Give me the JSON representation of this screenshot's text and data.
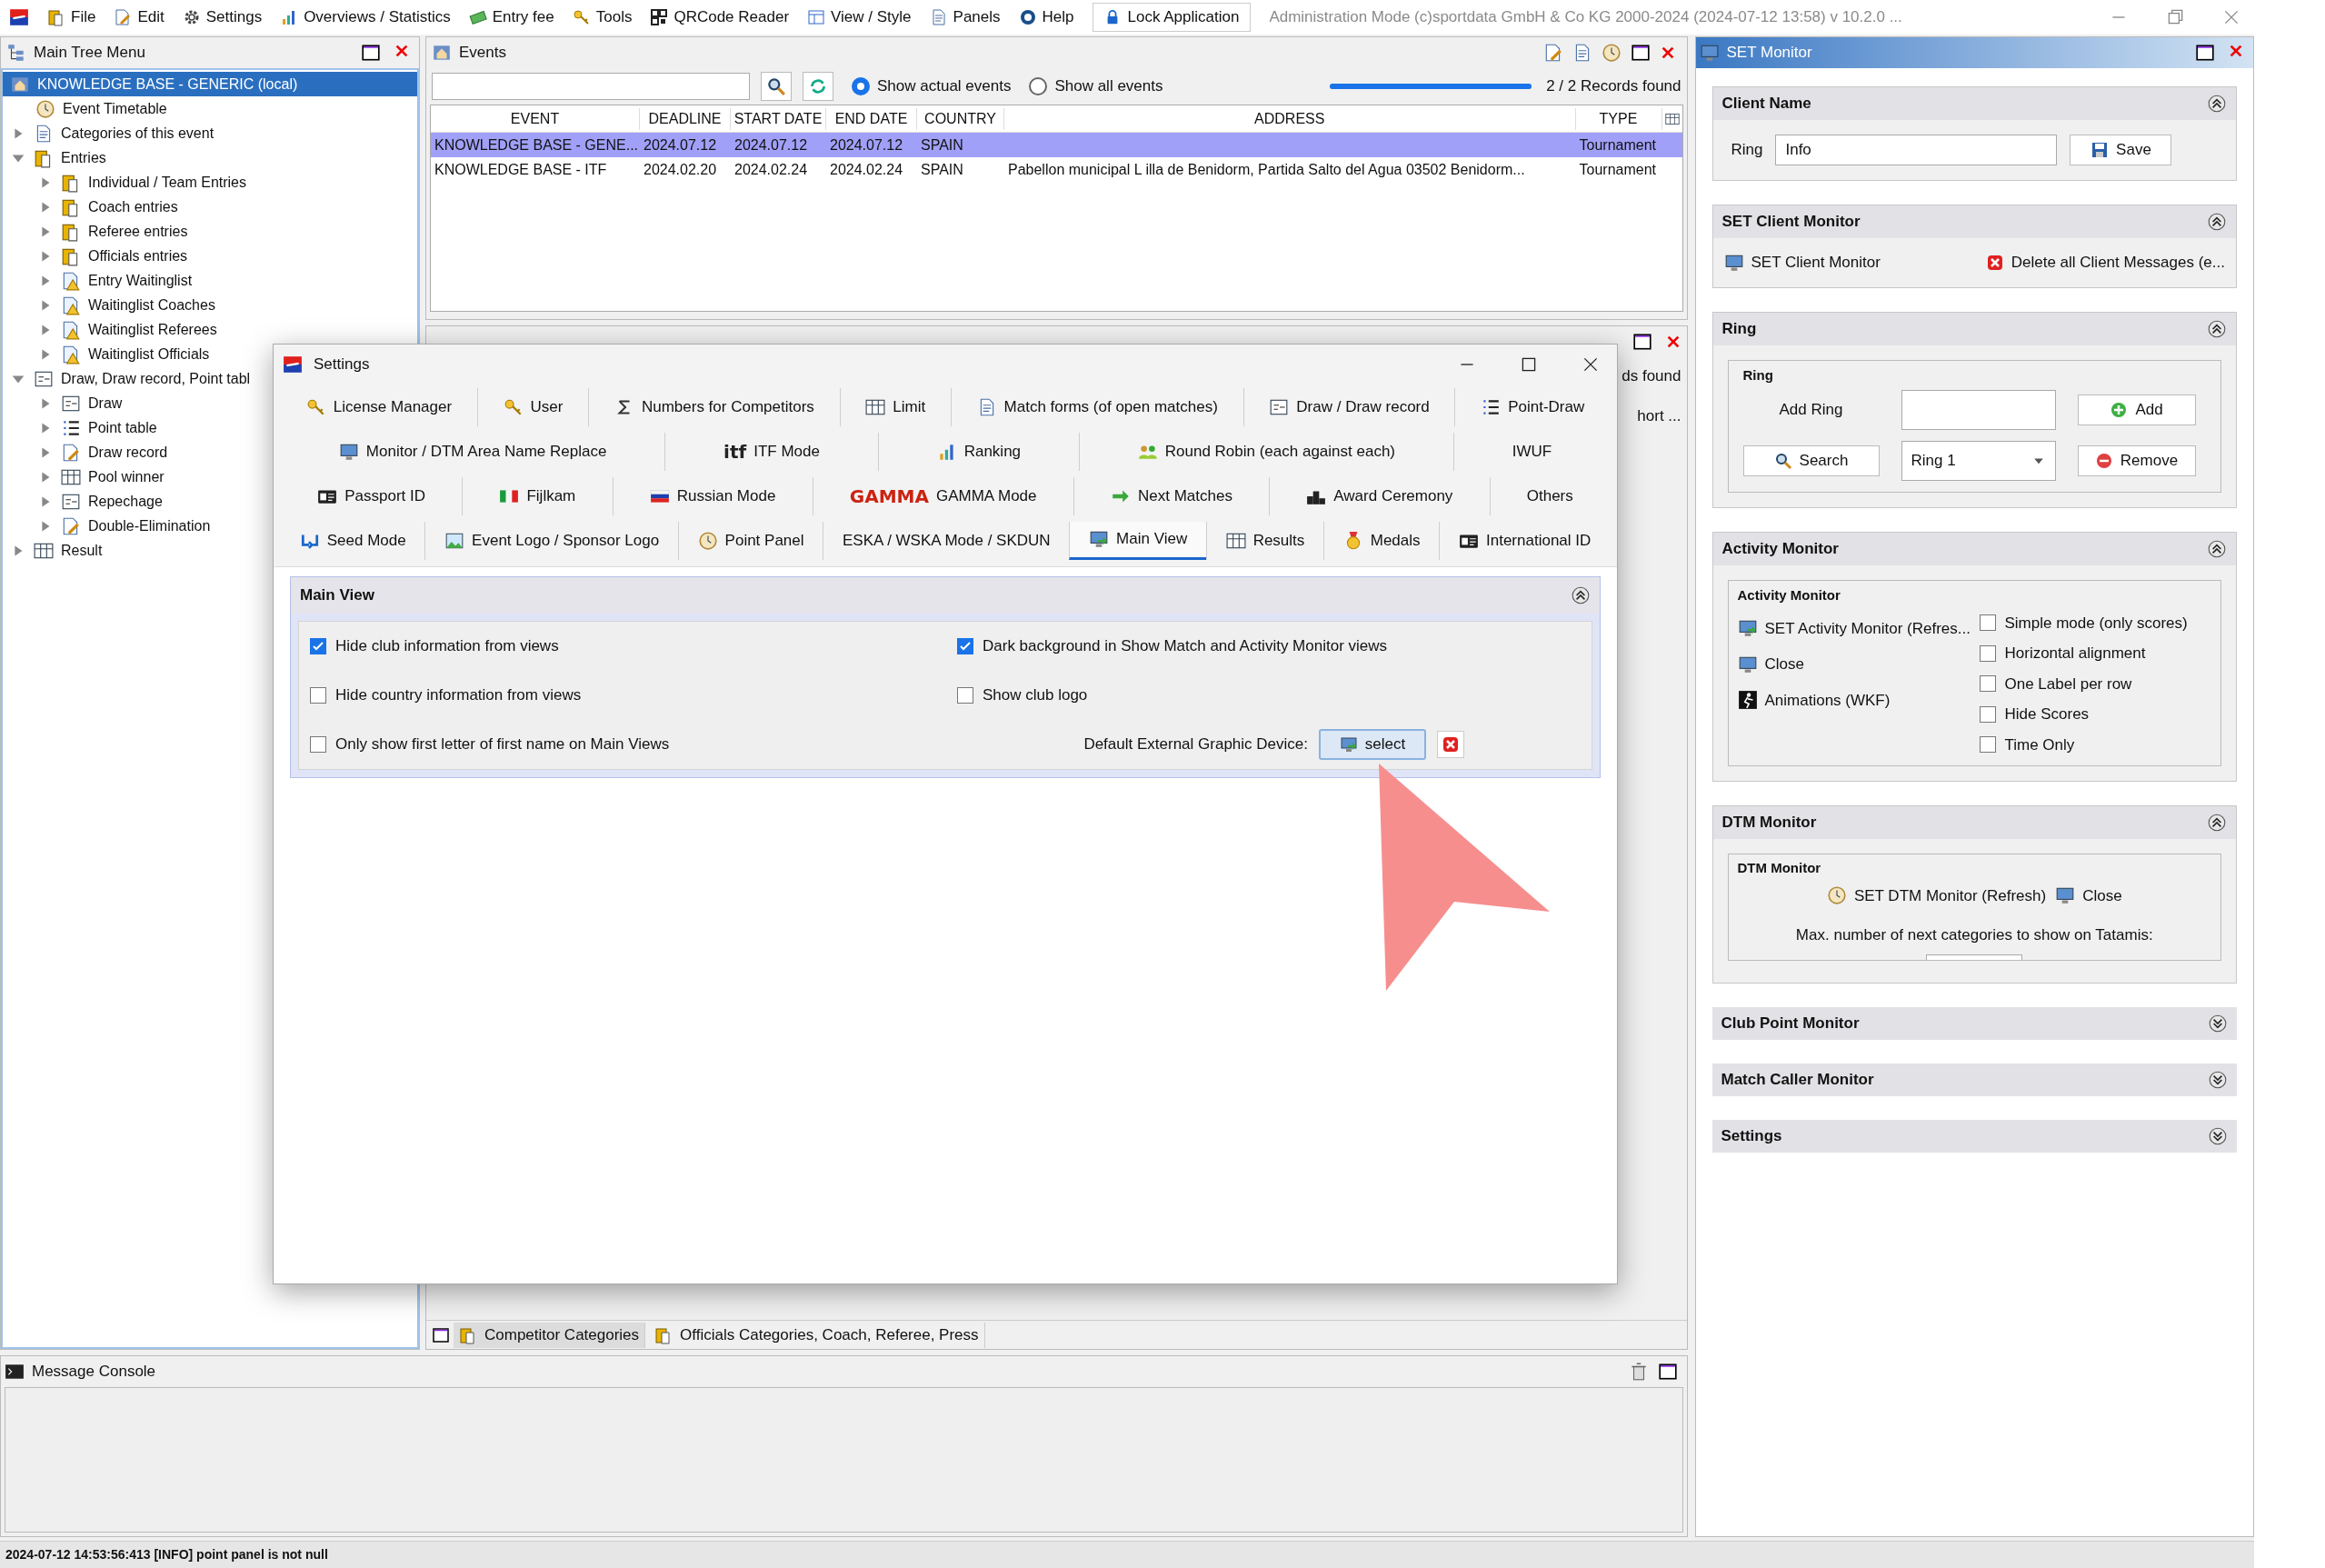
{
  "menu_bar": {
    "items": [
      {
        "label": "File"
      },
      {
        "label": "Edit"
      },
      {
        "label": "Settings"
      },
      {
        "label": "Overviews / Statistics"
      },
      {
        "label": "Entry fee"
      },
      {
        "label": "Tools"
      },
      {
        "label": "QRCode Reader"
      },
      {
        "label": "View / Style"
      },
      {
        "label": "Panels"
      },
      {
        "label": "Help"
      }
    ],
    "lock_button": "Lock Application",
    "title": "Administration Mode (c)sportdata GmbH & Co KG 2000-2024 (2024-07-12 13:58)  v 10.2.0 ..."
  },
  "main_tree": {
    "title": "Main Tree Menu",
    "root": {
      "label": "KNOWLEDGE BASE - GENERIC (local)",
      "selected": true,
      "children": [
        {
          "label": "Event Timetable",
          "selected": false
        },
        {
          "label": "Categories of this event",
          "selected": false,
          "expanded": false
        },
        {
          "label": "Entries",
          "selected": false,
          "expanded": true,
          "children": [
            {
              "label": "Individual / Team Entries",
              "selected": false,
              "expanded": false
            },
            {
              "label": "Coach entries",
              "selected": false,
              "expanded": false
            },
            {
              "label": "Referee entries",
              "selected": false,
              "expanded": false
            },
            {
              "label": "Officials entries",
              "selected": false,
              "expanded": false
            },
            {
              "label": "Entry Waitinglist",
              "selected": false,
              "expanded": false
            },
            {
              "label": "Waitinglist Coaches",
              "selected": false,
              "expanded": false
            },
            {
              "label": "Waitinglist Referees",
              "selected": false,
              "expanded": false
            },
            {
              "label": "Waitinglist Officials",
              "selected": false,
              "expanded": false
            }
          ]
        },
        {
          "label": "Draw, Draw record, Point tabl",
          "selected": false,
          "expanded": true,
          "children": [
            {
              "label": "Draw",
              "selected": false,
              "expanded": false
            },
            {
              "label": "Point table",
              "selected": false,
              "expanded": false
            },
            {
              "label": "Draw record",
              "selected": false,
              "expanded": false
            },
            {
              "label": "Pool winner",
              "selected": false,
              "expanded": false
            },
            {
              "label": "Repechage",
              "selected": false,
              "expanded": false
            },
            {
              "label": "Double-Elimination",
              "selected": false,
              "expanded": false
            }
          ]
        },
        {
          "label": "Result",
          "selected": false,
          "expanded": false
        }
      ]
    }
  },
  "events": {
    "title": "Events",
    "radios": [
      {
        "label": "Show actual events",
        "selected": true
      },
      {
        "label": "Show all events",
        "selected": false
      }
    ],
    "progress": {
      "level": 1
    },
    "records": "2 / 2 Records found",
    "columns": [
      "EVENT",
      "DEADLINE",
      "START DATE",
      "END DATE",
      "COUNTRY",
      "ADDRESS",
      "TYPE"
    ],
    "rows": [
      {
        "selected": true,
        "cells": [
          "KNOWLEDGE BASE - GENE...",
          "2024.07.12",
          "2024.07.12",
          "2024.07.12",
          "SPAIN",
          "",
          "Tournament"
        ]
      },
      {
        "selected": false,
        "cells": [
          "KNOWLEDGE BASE - ITF",
          "2024.02.20",
          "2024.02.24",
          "2024.02.24",
          "SPAIN",
          "Pabellon municipal L illa de Benidorm, Partida Salto del Agua 03502 Benidorm...",
          "Tournament"
        ]
      }
    ]
  },
  "competitor_panel": {
    "side_texts": [
      "ds found",
      "hort ..."
    ],
    "tabs": [
      {
        "label": "Competitor Categories",
        "selected": true
      },
      {
        "label": "Officials Categories, Coach, Referee, Press",
        "selected": false
      }
    ]
  },
  "settings_dialog": {
    "title": "Settings",
    "tab_rows": [
      [
        {
          "label": "License Manager",
          "selected": false
        },
        {
          "label": "User",
          "selected": false
        },
        {
          "label": "Numbers for Competitors",
          "selected": false
        },
        {
          "label": "Limit",
          "selected": false
        },
        {
          "label": "Match forms (of open matches)",
          "selected": false
        },
        {
          "label": "Draw / Draw record",
          "selected": false
        },
        {
          "label": "Point-Draw",
          "selected": false
        }
      ],
      [
        {
          "label": "Monitor / DTM Area Name Replace",
          "selected": false
        },
        {
          "label": "ITF Mode",
          "selected": false,
          "logo": "itf"
        },
        {
          "label": "Ranking",
          "selected": false
        },
        {
          "label": "Round Robin (each against each)",
          "selected": false
        },
        {
          "label": "IWUF",
          "selected": false
        }
      ],
      [
        {
          "label": "Passport ID",
          "selected": false
        },
        {
          "label": "Fijlkam",
          "selected": false
        },
        {
          "label": "Russian Mode",
          "selected": false
        },
        {
          "label": "GAMMA Mode",
          "selected": false,
          "logo": "GAMMA"
        },
        {
          "label": "Next Matches",
          "selected": false
        },
        {
          "label": "Award Ceremony",
          "selected": false
        },
        {
          "label": "Others",
          "selected": false
        }
      ],
      [
        {
          "label": "Seed Mode",
          "selected": false
        },
        {
          "label": "Event Logo / Sponsor Logo",
          "selected": false
        },
        {
          "label": "Point Panel",
          "selected": false
        },
        {
          "label": "ESKA / WSKA Mode / SKDUN",
          "selected": false
        },
        {
          "label": "Main View",
          "selected": true
        },
        {
          "label": "Results",
          "selected": false
        },
        {
          "label": "Medals",
          "selected": false
        },
        {
          "label": "International ID",
          "selected": false
        }
      ]
    ],
    "panel": {
      "title": "Main View",
      "expanded": true,
      "left_options": [
        {
          "label": "Hide club information from views",
          "checked": true
        },
        {
          "label": "Hide country information from views",
          "checked": false
        },
        {
          "label": "Only show first letter of first name on Main Views",
          "checked": false
        }
      ],
      "right_options": [
        {
          "label": "Dark background in Show Match and Activity Monitor views",
          "checked": true
        },
        {
          "label": "Show club logo",
          "checked": false
        }
      ],
      "device_label": "Default External Graphic Device:",
      "device_button": "select"
    }
  },
  "message_console": {
    "title": "Message Console"
  },
  "set_monitor": {
    "title": "SET Monitor",
    "sections": [
      {
        "kind": "client_name",
        "title": "Client Name",
        "expanded": true,
        "label": "Ring",
        "value": "Info",
        "button": "Save"
      },
      {
        "kind": "client_monitor",
        "title": "SET Client Monitor",
        "expanded": true,
        "actions": [
          "SET Client Monitor",
          "Delete all Client Messages (e..."
        ]
      },
      {
        "kind": "ring",
        "title": "Ring",
        "expanded": true,
        "group": "Ring",
        "add_label": "Add Ring",
        "add_button": "Add",
        "search_button": "Search",
        "ring_select": "Ring 1",
        "remove_button": "Remove"
      },
      {
        "kind": "activity",
        "title": "Activity Monitor",
        "expanded": true,
        "group": "Activity Monitor",
        "actions": [
          "SET Activity Monitor (Refres...",
          "Close",
          "Animations (WKF)"
        ],
        "options": [
          {
            "label": "Simple mode (only scores)",
            "checked": false
          },
          {
            "label": "Horizontal alignment",
            "checked": false
          },
          {
            "label": "One Label per row",
            "checked": false
          },
          {
            "label": "Hide Scores",
            "checked": false
          },
          {
            "label": "Time Only",
            "checked": false
          }
        ]
      },
      {
        "kind": "dtm",
        "title": "DTM Monitor",
        "expanded": true,
        "group": "DTM Monitor",
        "actions": [
          "SET DTM Monitor (Refresh)",
          "Close"
        ],
        "note": "Max. number of next categories to show on Tatamis:"
      },
      {
        "title": "Club Point Monitor",
        "expanded": false
      },
      {
        "title": "Match Caller Monitor",
        "expanded": false
      },
      {
        "title": "Settings",
        "expanded": false
      }
    ]
  },
  "status_bar": "2024-07-12 14:53:56:413 [INFO] point panel is not null"
}
